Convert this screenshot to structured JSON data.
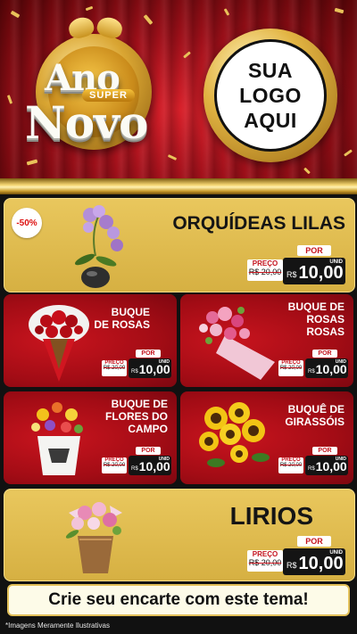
{
  "header": {
    "title_word_1": "Ano",
    "title_badge": "SUPER",
    "title_word_2": "Novo",
    "logo_line_1": "SUA",
    "logo_line_2": "LOGO",
    "logo_line_3": "AQUI"
  },
  "featured_top": {
    "badge": "-50%",
    "name": "ORQUÍDEAS LILAS",
    "por_label": "POR",
    "old_label": "PREÇO",
    "old_price": "R$ 20,00",
    "currency": "R$",
    "new_price": "10,00",
    "unit": "UNID"
  },
  "products": [
    {
      "name_lines": [
        "BUQUE",
        "DE ROSAS"
      ],
      "por_label": "POR",
      "old_label": "PREÇO",
      "old_price": "R$ 20,00",
      "currency": "R$",
      "new_price": "10,00",
      "unit": "UNID"
    },
    {
      "name_lines": [
        "BUQUE DE",
        "ROSAS",
        "ROSAS"
      ],
      "por_label": "POR",
      "old_label": "PREÇO",
      "old_price": "R$ 20,00",
      "currency": "R$",
      "new_price": "10,00",
      "unit": "UNID"
    },
    {
      "name_lines": [
        "BUQUE DE",
        "FLORES DO",
        "CAMPO"
      ],
      "por_label": "POR",
      "old_label": "PREÇO",
      "old_price": "R$ 20,00",
      "currency": "R$",
      "new_price": "10,00",
      "unit": "UNID"
    },
    {
      "name_lines": [
        "BUQUÊ DE",
        "GIRASSÓIS"
      ],
      "por_label": "POR",
      "old_label": "PREÇO",
      "old_price": "R$ 20,00",
      "currency": "R$",
      "new_price": "10,00",
      "unit": "UNID"
    }
  ],
  "featured_bottom": {
    "name": "LIRIOS",
    "por_label": "POR",
    "old_label": "PREÇO",
    "old_price": "R$ 20,00",
    "currency": "R$",
    "new_price": "10,00",
    "unit": "UNID"
  },
  "cta": "Crie seu encarte com este tema!",
  "footnote": "*Imagens Meramente Ilustrativas",
  "colors": {
    "gold": "#e9c75d",
    "red": "#b50f18",
    "price_red": "#c4121c",
    "price_black": "#141414"
  }
}
